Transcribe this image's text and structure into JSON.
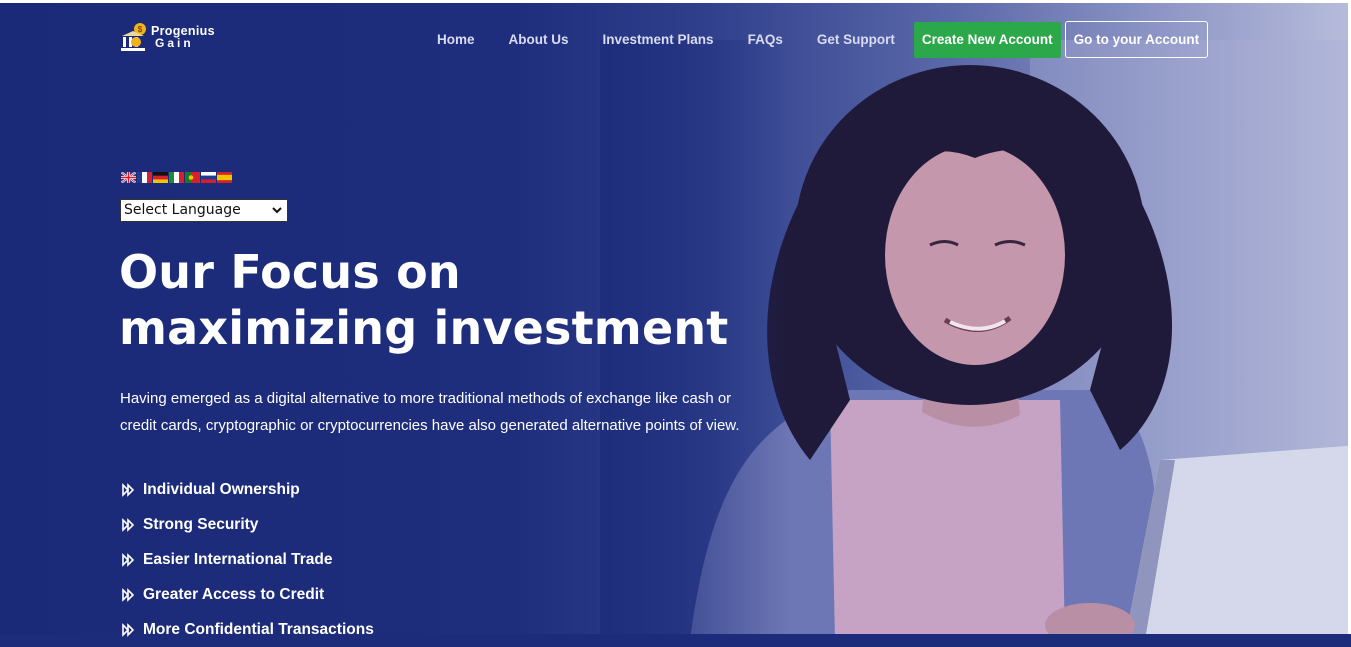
{
  "brand": {
    "line1": "Progenius",
    "line2": "Gain"
  },
  "nav": {
    "items": [
      "Home",
      "About Us",
      "Investment Plans",
      "FAQs",
      "Get Support"
    ],
    "create_account": "Create New Account",
    "go_account": "Go to your Account"
  },
  "language": {
    "flags": [
      "uk-flag",
      "france-flag",
      "germany-flag",
      "italy-flag",
      "portugal-flag",
      "russia-flag",
      "spain-flag"
    ],
    "select_label": "Select Language"
  },
  "hero": {
    "headline": "Our Focus on maximizing investment",
    "paragraph": "Having emerged as a digital alternative to more traditional methods of exchange like cash or credit cards, cryptographic or cryptocurrencies have also generated alternative points of view.",
    "features": [
      "Individual Ownership",
      "Strong Security",
      "Easier International Trade",
      "Greater Access to Credit",
      "More Confidential Transactions"
    ]
  },
  "colors": {
    "background": "#1c2b7a",
    "create_button": "#2aa84a",
    "text": "#ffffff"
  }
}
